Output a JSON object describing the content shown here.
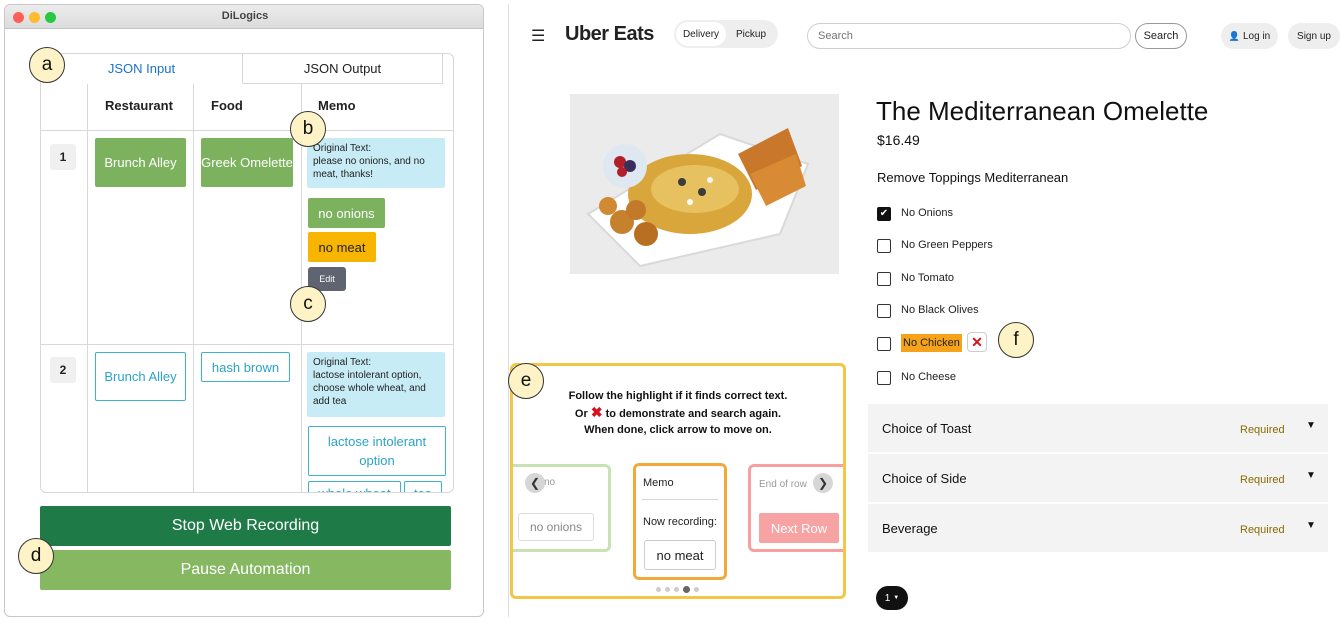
{
  "left_app": {
    "window_title": "DiLogics",
    "tabs": [
      "JSON Input",
      "JSON Output"
    ],
    "columns": [
      "Restaurant",
      "Food",
      "Memo"
    ],
    "rows": [
      {
        "index": "1",
        "restaurant": "Brunch Alley",
        "food": "Greek Omelette",
        "memo_text": "Original Text:\nplease no onions, and no meat, thanks!",
        "memo_chips": [
          "no onions",
          "no meat"
        ],
        "edit_label": "Edit"
      },
      {
        "index": "2",
        "restaurant": "Brunch Alley",
        "food": "hash brown",
        "memo_text": "Original Text:\nlactose intolerant option, choose whole wheat, and add tea",
        "memo_chips": [
          "lactose intolerant option",
          "whole wheat",
          "tea"
        ]
      }
    ],
    "stop_button": "Stop Web Recording",
    "pause_button": "Pause Automation"
  },
  "callouts": [
    "a",
    "b",
    "c",
    "d",
    "e",
    "f"
  ],
  "uber": {
    "logo": "Uber Eats",
    "menu_icon": "hamburger-icon",
    "toggle": [
      "Delivery",
      "Pickup"
    ],
    "search_placeholder": "Search",
    "search_button": "Search",
    "login": "Log in",
    "signup": "Sign up",
    "item_title": "The Mediterranean Omelette",
    "price": "$16.49",
    "section_title": "Remove Toppings Mediterranean",
    "options": [
      {
        "label": "No Onions",
        "checked": true
      },
      {
        "label": "No Green Peppers",
        "checked": false
      },
      {
        "label": "No Tomato",
        "checked": false
      },
      {
        "label": "No Black Olives",
        "checked": false
      },
      {
        "label": "No Chicken",
        "checked": false,
        "highlighted": true
      },
      {
        "label": "No Cheese",
        "checked": false
      }
    ],
    "accordions": [
      {
        "label": "Choice of Toast",
        "badge": "Required"
      },
      {
        "label": "Choice of Side",
        "badge": "Required"
      },
      {
        "label": "Beverage",
        "badge": "Required"
      }
    ],
    "quantity": "1",
    "highlight_color": "#f7a21b"
  },
  "overlay": {
    "line1": "Follow the highlight if it finds correct text.",
    "line2_prefix": "Or",
    "line2_suffix": "to demonstrate and search again.",
    "line3": "When done, click arrow to move on.",
    "left_card_label": "no",
    "left_card_chip": "no onions",
    "center_header": "Memo",
    "center_status": "Now recording:",
    "center_value": "no meat",
    "right_card_label": "End of row",
    "right_card_button": "Next Row",
    "dots_total": 5,
    "dots_active": 4
  }
}
